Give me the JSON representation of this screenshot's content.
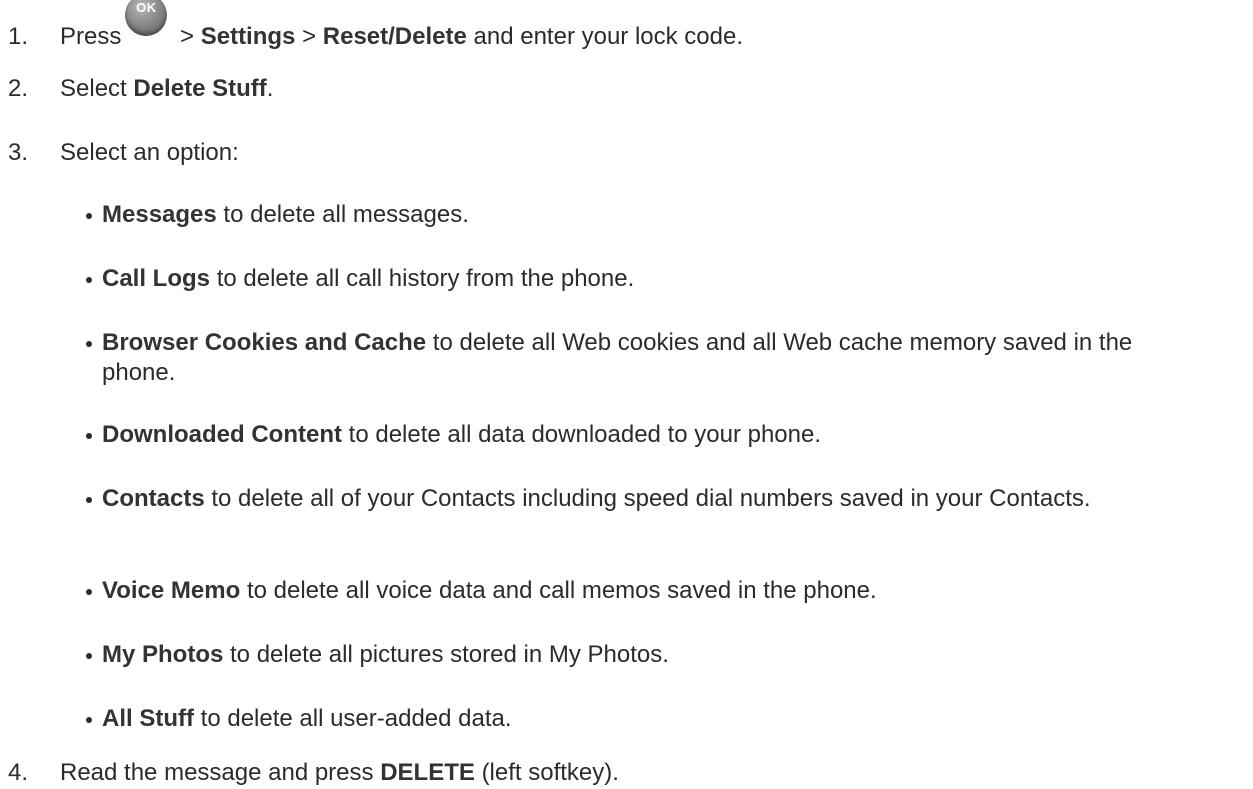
{
  "steps": [
    {
      "number": "1.",
      "press": "Press",
      "ok_label": "OK",
      "sep1": ">",
      "settings": "Settings",
      "sep2": ">",
      "reset_delete": "Reset/Delete",
      "tail": "and enter your lock code."
    },
    {
      "number": "2.",
      "text": "Select",
      "bold": "Delete Stuff",
      "tail": "."
    },
    {
      "number": "3.",
      "text": "Select an option:"
    },
    {
      "number": "4.",
      "text": "Read the message and press",
      "bold": "DELETE",
      "tail": "(left softkey)."
    }
  ],
  "options": [
    {
      "bold": "Messages",
      "text": "to delete all messages."
    },
    {
      "bold": "Call Logs",
      "text": "to delete all call history from the phone."
    },
    {
      "bold": "Browser Cookies and Cache",
      "text": "to delete all Web cookies and all Web cache memory saved in the phone."
    },
    {
      "bold": "Downloaded Content",
      "text": "to delete all data downloaded to your phone."
    },
    {
      "bold": "Contacts",
      "text": "to delete all of your Contacts including speed dial numbers saved in your Contacts."
    },
    {
      "bold": "Voice Memo",
      "text": "to delete all voice data and call memos saved in the phone."
    },
    {
      "bold": "My Photos",
      "text": "to delete all pictures stored in My Photos."
    },
    {
      "bold": "All Stuff",
      "text": "to delete all user-added data."
    }
  ]
}
